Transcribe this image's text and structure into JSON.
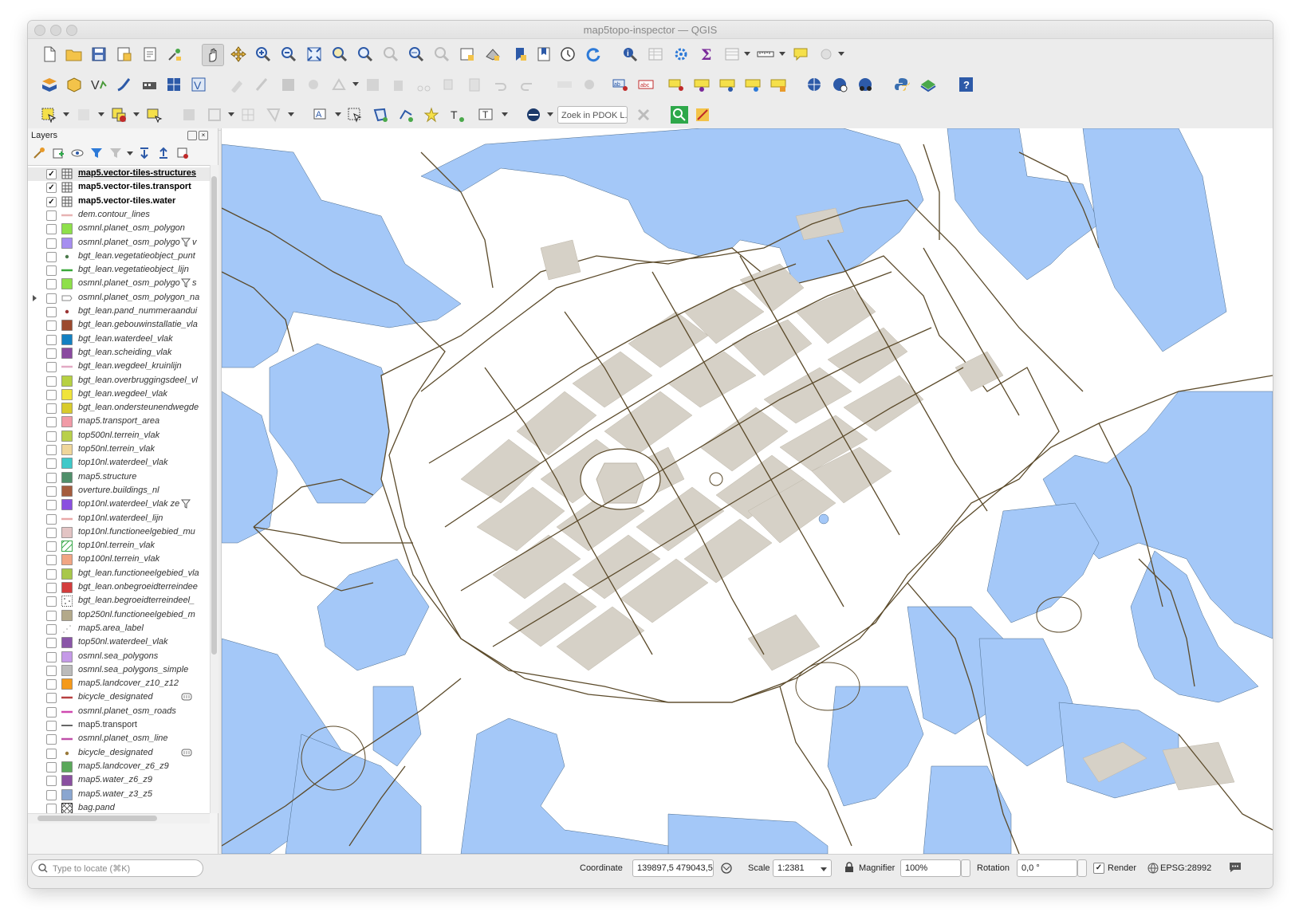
{
  "window": {
    "title": "map5topo-inspector — QGIS"
  },
  "layers_panel": {
    "title": "Layers",
    "layers": [
      {
        "name": "map5.vector-tiles-structures",
        "checked": true,
        "bold": true,
        "underline": true,
        "symbol": "grid-icon",
        "color": "#555555",
        "selected": true
      },
      {
        "name": "map5.vector-tiles.transport",
        "checked": true,
        "bold": true,
        "symbol": "grid-icon",
        "color": "#555555"
      },
      {
        "name": "map5.vector-tiles.water",
        "checked": true,
        "bold": true,
        "symbol": "grid-icon",
        "color": "#555555"
      },
      {
        "name": "dem.contour_lines",
        "symbol": "line",
        "color": "#e7b3b3"
      },
      {
        "name": "osmnl.planet_osm_polygon",
        "symbol": "fill",
        "color": "#8ee04a"
      },
      {
        "name": "osmnl.planet_osm_polygo",
        "symbol": "fill",
        "color": "#a68ef0",
        "filter": true,
        "suffix": "v"
      },
      {
        "name": "bgt_lean.vegetatieobject_punt",
        "symbol": "point",
        "color": "#4b7a4b"
      },
      {
        "name": "bgt_lean.vegetatieobject_lijn",
        "symbol": "line",
        "color": "#3aa83a"
      },
      {
        "name": "osmnl.planet_osm_polygo",
        "symbol": "fill",
        "color": "#8ee04a",
        "filter": true,
        "suffix": "s"
      },
      {
        "name": "osmnl.planet_osm_polygon_na",
        "symbol": "label",
        "color": "#cccccc",
        "expandable": true
      },
      {
        "name": "bgt_lean.pand_nummeraandui",
        "symbol": "point",
        "color": "#9a3535"
      },
      {
        "name": "bgt_lean.gebouwinstallatie_vla",
        "symbol": "fill",
        "color": "#9c4a2e"
      },
      {
        "name": "bgt_lean.waterdeel_vlak",
        "symbol": "fill",
        "color": "#1380c2"
      },
      {
        "name": "bgt_lean.scheiding_vlak",
        "symbol": "fill",
        "color": "#8a4aa0"
      },
      {
        "name": "bgt_lean.wegdeel_kruinlijn",
        "symbol": "line",
        "color": "#e2a9c4"
      },
      {
        "name": "bgt_lean.overbruggingsdeel_vl",
        "symbol": "fill",
        "color": "#b7d142"
      },
      {
        "name": "bgt_lean.wegdeel_vlak",
        "symbol": "fill",
        "color": "#f0e43a"
      },
      {
        "name": "bgt_lean.ondersteunendwegde",
        "symbol": "fill",
        "color": "#d8cb2c"
      },
      {
        "name": "map5.transport_area",
        "symbol": "fill",
        "color": "#f19aa6"
      },
      {
        "name": "top500nl.terrein_vlak",
        "symbol": "fill",
        "color": "#b9d04a"
      },
      {
        "name": "top50nl.terrein_vlak",
        "symbol": "fill",
        "color": "#efd69a"
      },
      {
        "name": "top10nl.waterdeel_vlak",
        "symbol": "fill",
        "color": "#3fc9c9"
      },
      {
        "name": "map5.structure",
        "symbol": "fill",
        "color": "#4f8f6a"
      },
      {
        "name": "overture.buildings_nl",
        "symbol": "fill",
        "color": "#a45c3e"
      },
      {
        "name": "top10nl.waterdeel_vlak ze",
        "symbol": "fill",
        "color": "#8a4fe0",
        "filter": true
      },
      {
        "name": "top10nl.waterdeel_lijn",
        "symbol": "line",
        "color": "#e8a8a8"
      },
      {
        "name": "top10nl.functioneelgebied_mu",
        "symbol": "fill",
        "color": "#e3c4c4"
      },
      {
        "name": "top10nl.terrein_vlak",
        "symbol": "hatch",
        "color": "#3aa84a"
      },
      {
        "name": "top100nl.terrein_vlak",
        "symbol": "fill",
        "color": "#f1a583"
      },
      {
        "name": "bgt_lean.functioneelgebied_vla",
        "symbol": "fill",
        "color": "#a8c84a"
      },
      {
        "name": "bgt_lean.onbegroeidterreindee",
        "symbol": "fill",
        "color": "#d43c3c"
      },
      {
        "name": "bgt_lean.begroeidterreindeel_",
        "symbol": "dots",
        "color": "#333333"
      },
      {
        "name": "top250nl.functioneelgebied_m",
        "symbol": "fill",
        "color": "#b3a98a"
      },
      {
        "name": "map5.area_label",
        "symbol": "labeldots",
        "color": "#999999"
      },
      {
        "name": "top50nl.waterdeel_vlak",
        "symbol": "fill",
        "color": "#8a55a8"
      },
      {
        "name": "osmnl.sea_polygons",
        "symbol": "fill",
        "color": "#c59ae8"
      },
      {
        "name": "osmnl.sea_polygons_simple",
        "symbol": "fill",
        "color": "#bbbbbb"
      },
      {
        "name": "map5.landcover_z10_z12",
        "symbol": "fill",
        "color": "#f59a1a"
      },
      {
        "name": "bicycle_designated",
        "symbol": "line",
        "color": "#b74040",
        "embedded": true
      },
      {
        "name": "osmnl.planet_osm_roads",
        "symbol": "line",
        "color": "#d04ab0"
      },
      {
        "name": "map5.transport",
        "symbol": "line",
        "color": "#333333",
        "plain": true
      },
      {
        "name": "osmnl.planet_osm_line",
        "symbol": "line",
        "color": "#c050a8"
      },
      {
        "name": "bicycle_designated",
        "symbol": "point",
        "color": "#9a7a3a",
        "embedded": true
      },
      {
        "name": "map5.landcover_z6_z9",
        "symbol": "fill",
        "color": "#5aa85a"
      },
      {
        "name": "map5.water_z6_z9",
        "symbol": "fill",
        "color": "#8a4fa0"
      },
      {
        "name": "map5.water_z3_z5",
        "symbol": "fill",
        "color": "#8aa6d0"
      },
      {
        "name": "bag.pand",
        "symbol": "crosshatch",
        "color": "#333333"
      }
    ]
  },
  "toolbar": {
    "pdok_search_placeholder": "Zoek in PDOK L..."
  },
  "statusbar": {
    "locate_placeholder": "Type to locate (⌘K)",
    "coordinate_label": "Coordinate",
    "coordinate_value": "139897,5 479043,5",
    "scale_label": "Scale",
    "scale_value": "1:2381",
    "magnifier_label": "Magnifier",
    "magnifier_value": "100%",
    "rotation_label": "Rotation",
    "rotation_value": "0,0 °",
    "render_label": "Render",
    "render_checked": true,
    "crs": "EPSG:28992"
  },
  "colors": {
    "water": "#a4c8f8",
    "road": "#5b4a2a",
    "building": "#d6d1c7",
    "land": "#ffffff"
  }
}
